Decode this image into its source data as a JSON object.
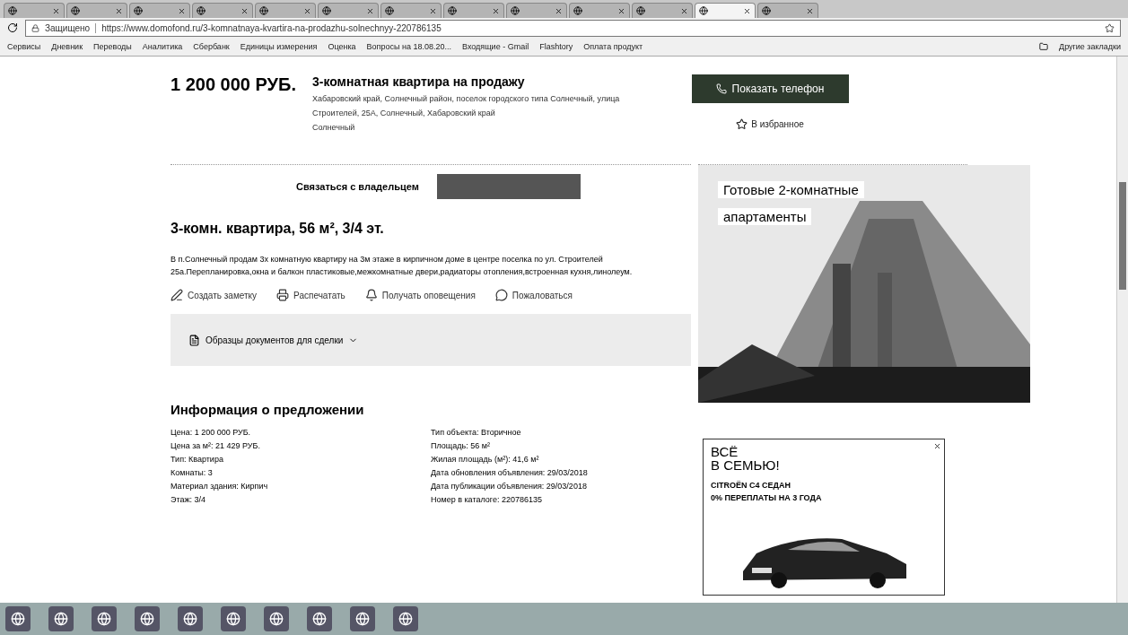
{
  "browser": {
    "tabs": [
      {
        "selected": false
      },
      {
        "selected": false
      },
      {
        "selected": false
      },
      {
        "selected": false
      },
      {
        "selected": false
      },
      {
        "selected": false
      },
      {
        "selected": false
      },
      {
        "selected": false
      },
      {
        "selected": false
      },
      {
        "selected": false
      },
      {
        "selected": false
      },
      {
        "selected": true
      },
      {
        "selected": false
      }
    ],
    "address": {
      "secure_label": "Защищено",
      "url": "https://www.domofond.ru/3-komnatnaya-kvartira-na-prodazhu-solnechnyy-220786135"
    },
    "bookmarks": [
      "Сервисы",
      "Дневник",
      "Переводы",
      "Аналитика",
      "Сбербанк",
      "Единицы измерения",
      "Оценка",
      "Вопросы на 18.08.20...",
      "Входящие - Gmail",
      "Flashtory",
      "Оплата продукт"
    ],
    "other_bookmarks": "Другие закладки"
  },
  "listing": {
    "price": "1 200 000 РУБ.",
    "title": "3-комнатная квартира на продажу",
    "address": "Хабаровский край, Солнечный район, поселок городского типа Солнечный, улица Строителей, 25А, Солнечный, Хабаровский край",
    "locality": "Солнечный",
    "phone_button": "Показать телефон",
    "favorite": {
      "label": "В избранное",
      "selected": false
    }
  },
  "contact": {
    "label": "Связаться с владельцем"
  },
  "summary": "3-комн. квартира, 56 м², 3/4 эт.",
  "description": "В п.Солнечный продам 3х комнатную квартиру на 3м этаже в кирпичном доме в центре поселка по ул. Строителей 25а.Перепланировка,окна и балкон пластиковые,межкомнатные двери,радиаторы отопления,встроенная кухня,линолеум.",
  "actions": [
    {
      "kind": "note",
      "label": "Создать заметку"
    },
    {
      "kind": "print",
      "label": "Распечатать"
    },
    {
      "kind": "alert",
      "label": "Получать оповещения"
    },
    {
      "kind": "complain",
      "label": "Пожаловаться"
    }
  ],
  "documents": {
    "label": "Образцы документов для сделки",
    "expanded": false
  },
  "info": {
    "title": "Информация о предложении",
    "left": [
      "Цена: 1 200 000 РУБ.",
      "Цена за м²: 21 429 РУБ.",
      "Тип: Квартира",
      "Комнаты: 3",
      "Материал здания: Кирпич",
      "Этаж: 3/4"
    ],
    "right": [
      "Тип объекта: Вторичное",
      "Площадь: 56 м²",
      "Жилая площадь (м²): 41,6 м²",
      "Дата обновления объявления: 29/03/2018",
      "Дата публикации объявления: 29/03/2018",
      "Номер в каталоге: 220786135"
    ]
  },
  "ads": [
    {
      "kind": "building",
      "headline": [
        "Готовые 2-комнатные",
        "апартаменты"
      ]
    },
    {
      "kind": "car",
      "headline": [
        "ВСЁ",
        "В СЕМЬЮ!"
      ],
      "body": [
        "CITROËN C4 СЕДАН",
        "0% ПЕРЕПЛАТЫ НА 3 ГОДА"
      ]
    }
  ]
}
